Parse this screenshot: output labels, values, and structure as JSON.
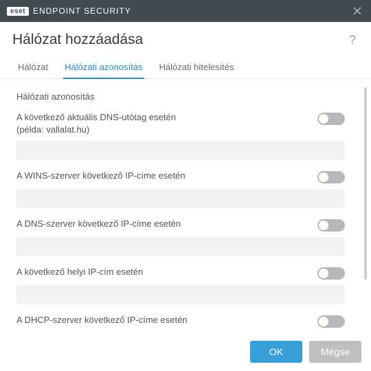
{
  "titlebar": {
    "brand_badge": "eset",
    "brand_text": "ENDPOINT SECURITY"
  },
  "header": {
    "title": "Hálózat hozzáadása",
    "help": "?"
  },
  "tabs": {
    "t0": "Hálózat",
    "t1": "Hálózati azonosítás",
    "t2": "Hálózati hitelesítés"
  },
  "section": {
    "title": "Hálózati azonosítás"
  },
  "rows": {
    "r0": {
      "label": "A következő aktuális DNS-utótag esetén (példa: vallalat.hu)",
      "value": ""
    },
    "r1": {
      "label": "A WINS-szerver következő IP-címe esetén",
      "value": ""
    },
    "r2": {
      "label": "A DNS-szerver következő IP-címe esetén",
      "value": ""
    },
    "r3": {
      "label": "A következő helyi IP-cím esetén",
      "value": ""
    },
    "r4": {
      "label": "A DHCP-szerver következő IP-címe esetén",
      "value": ""
    }
  },
  "footer": {
    "ok": "OK",
    "cancel": "Mégse"
  }
}
